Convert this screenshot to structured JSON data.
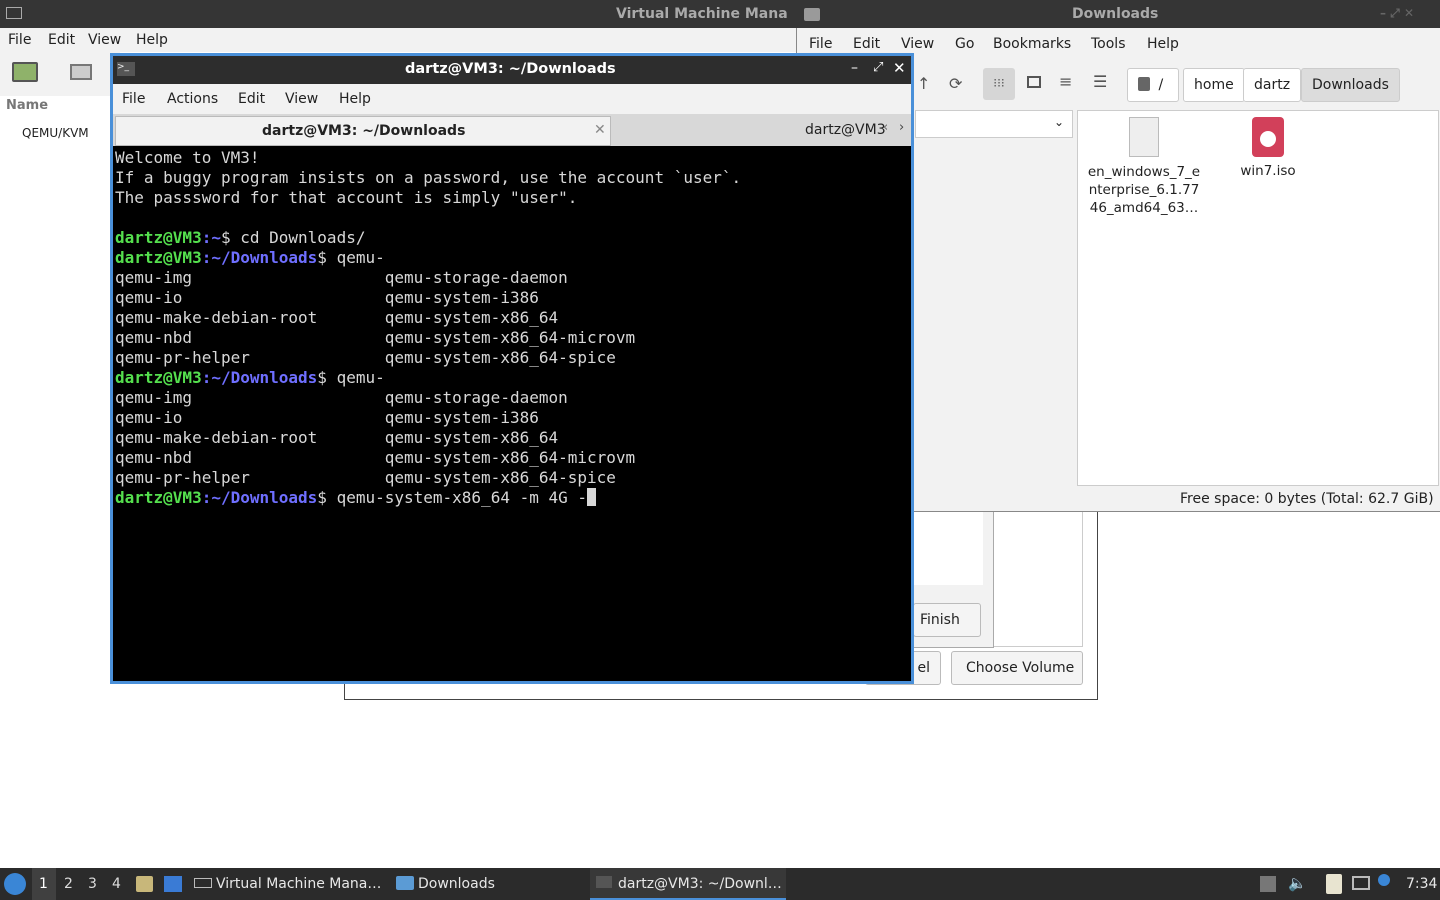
{
  "vmm": {
    "title": "Virtual Machine Mana",
    "menu": [
      "File",
      "Edit",
      "View",
      "Help"
    ],
    "column_name": "Name",
    "connection": "QEMU/KVM"
  },
  "wizard": {
    "finish_label": "Finish",
    "cancel_fragment": "el",
    "choose_volume_label": "Choose Volume"
  },
  "filemanager": {
    "title": "Downloads",
    "menu": [
      "File",
      "Edit",
      "View",
      "Go",
      "Bookmarks",
      "Tools",
      "Help"
    ],
    "path": [
      "/",
      "home",
      "dartz",
      "Downloads"
    ],
    "files": [
      {
        "name": "en_windows_7_e\nnterprise_6.1.77\n46_amd64_63…",
        "icon": "text-file-icon"
      },
      {
        "name": "win7.iso",
        "icon": "disc-image-icon"
      }
    ],
    "status": "Free space: 0 bytes (Total: 62.7 GiB)"
  },
  "terminal": {
    "title": "dartz@VM3: ~/Downloads",
    "menu": [
      "File",
      "Actions",
      "Edit",
      "View",
      "Help"
    ],
    "tabs": [
      "dartz@VM3: ~/Downloads",
      "dartz@VM3"
    ],
    "lines": [
      {
        "text": "Welcome to VM3!"
      },
      {
        "text": "If a buggy program insists on a password, use the account `user`."
      },
      {
        "text": "The passsword for that account is simply \"user\"."
      },
      {
        "text": ""
      },
      {
        "user": "dartz@VM3",
        "path": ":~",
        "cmd": "$ cd Downloads/"
      },
      {
        "user": "dartz@VM3",
        "path": ":~/Downloads",
        "cmd": "$ qemu-"
      },
      {
        "text": "qemu-img                    qemu-storage-daemon"
      },
      {
        "text": "qemu-io                     qemu-system-i386"
      },
      {
        "text": "qemu-make-debian-root       qemu-system-x86_64"
      },
      {
        "text": "qemu-nbd                    qemu-system-x86_64-microvm"
      },
      {
        "text": "qemu-pr-helper              qemu-system-x86_64-spice"
      },
      {
        "user": "dartz@VM3",
        "path": ":~/Downloads",
        "cmd": "$ qemu-"
      },
      {
        "text": "qemu-img                    qemu-storage-daemon"
      },
      {
        "text": "qemu-io                     qemu-system-i386"
      },
      {
        "text": "qemu-make-debian-root       qemu-system-x86_64"
      },
      {
        "text": "qemu-nbd                    qemu-system-x86_64-microvm"
      },
      {
        "text": "qemu-pr-helper              qemu-system-x86_64-spice"
      },
      {
        "user": "dartz@VM3",
        "path": ":~/Downloads",
        "cmd": "$ qemu-system-x86_64 -m 4G -",
        "cursor": true
      }
    ]
  },
  "taskbar": {
    "workspaces": [
      "1",
      "2",
      "3",
      "4"
    ],
    "tasks": [
      "Virtual Machine Mana…",
      "Downloads",
      "dartz@VM3: ~/Downl…"
    ],
    "clock": "7:34"
  },
  "colors": {
    "prompt_user": "#55e04e",
    "prompt_path": "#6f6fff",
    "focus_border": "#4a90d9"
  }
}
